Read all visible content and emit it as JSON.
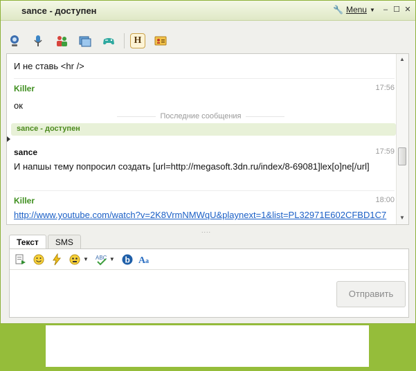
{
  "window": {
    "title": "sance - доступен",
    "menu_label": "Menu"
  },
  "toolbar": {
    "icons": [
      "webcam-icon",
      "microphone-icon",
      "contacts-icon",
      "windows-icon",
      "gamepad-icon",
      "history-icon",
      "contact-card-icon"
    ],
    "history_glyph": "H"
  },
  "chat": {
    "partial_message": "И не ставь <hr />",
    "messages": [
      {
        "sender": "Killer",
        "time": "17:56",
        "text": "ок",
        "sender_color": "#3f8f1f"
      },
      {
        "sender": "sance",
        "time": "17:59",
        "text": "И напшы тему попросил создать [url=http://megasoft.3dn.ru/index/8-69081]lex[o]ne[/url]",
        "sender_color": "#111111"
      },
      {
        "sender": "Killer",
        "time": "18:00",
        "link": "http://www.youtube.com/watch?v=2K8VrmNMWqU&playnext=1&list=PL32971E602CFBD1C7",
        "sender_color": "#3f8f1f"
      }
    ],
    "recent_label": "Последние сообщения",
    "status_text": "sance - доступен"
  },
  "composer": {
    "tabs": [
      "Текст",
      "SMS"
    ],
    "active_tab": "Текст",
    "send_label": "Отправить",
    "input_value": ""
  },
  "colors": {
    "background": "#95bd3a",
    "accent_green": "#3f8f1f",
    "link": "#1a5fc6"
  }
}
